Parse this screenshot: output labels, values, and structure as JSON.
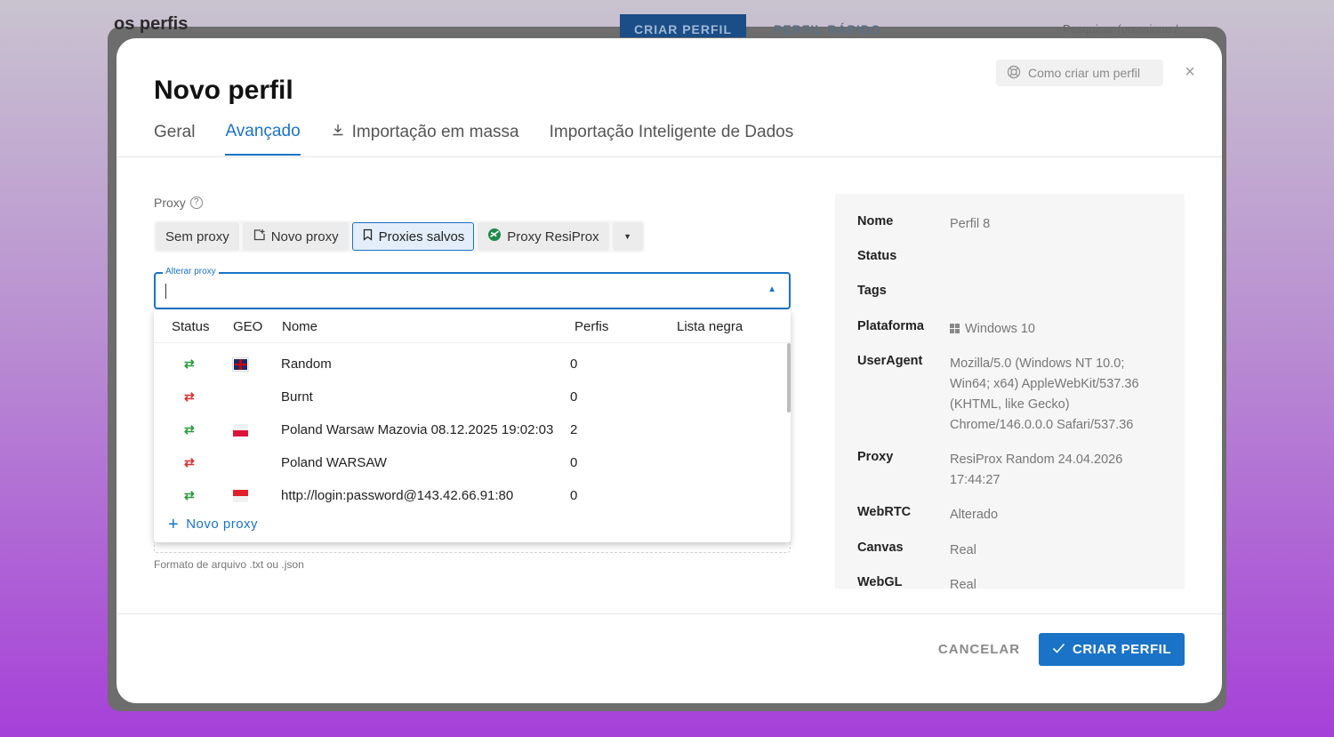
{
  "background_app": {
    "title": "os perfis",
    "create_button": "CRIAR PERFIL",
    "quick_profile_button": "PERFIL RÁPIDO",
    "search_placeholder": "Pesquisar (pressione /"
  },
  "modal": {
    "title": "Novo perfil",
    "help_button": "Como criar um perfil",
    "close_icon": "close-icon",
    "tabs": [
      {
        "label": "Geral",
        "active": false
      },
      {
        "label": "Avançado",
        "active": true
      },
      {
        "label": "Importação em massa",
        "icon": "download-icon",
        "active": false
      },
      {
        "label": "Importação Inteligente de Dados",
        "active": false
      }
    ]
  },
  "proxy": {
    "label": "Proxy",
    "options": [
      {
        "label": "Sem proxy"
      },
      {
        "label": "Novo proxy",
        "icon": "new-window-icon"
      },
      {
        "label": "Proxies salvos",
        "icon": "bookmark-icon",
        "selected": true
      },
      {
        "label": "Proxy ResiProx",
        "icon": "resiprox-logo-icon"
      }
    ],
    "select": {
      "legend": "Alterar proxy",
      "value": ""
    },
    "table": {
      "headers": [
        "Status",
        "GEO",
        "Nome",
        "Perfis",
        "Lista negra"
      ],
      "rows": [
        {
          "status": "ok",
          "geo": "uk",
          "name": "Random",
          "profiles": "0"
        },
        {
          "status": "bad",
          "geo": "",
          "name": "Burnt",
          "profiles": "0"
        },
        {
          "status": "ok",
          "geo": "pl",
          "name": "Poland Warsaw Mazovia 08.12.2025 19:02:03",
          "profiles": "2"
        },
        {
          "status": "bad",
          "geo": "",
          "name": "Poland WARSAW",
          "profiles": "0"
        },
        {
          "status": "ok",
          "geo": "sg",
          "name": "http://login:password@143.42.66.91:80",
          "profiles": "0"
        }
      ],
      "add_label": "Novo proxy"
    },
    "file_hint": "Formato de arquivo .txt ou .json"
  },
  "summary": {
    "rows": [
      {
        "key": "Nome",
        "value": "Perfil 8"
      },
      {
        "key": "Status",
        "value": ""
      },
      {
        "key": "Tags",
        "value": ""
      },
      {
        "key": "Plataforma",
        "value": "Windows 10"
      },
      {
        "key": "UserAgent",
        "value": "Mozilla/5.0 (Windows NT 10.0; Win64; x64) AppleWebKit/537.36 (KHTML, like Gecko) Chrome/146.0.0.0 Safari/537.36"
      },
      {
        "key": "Proxy",
        "value": "ResiProx Random 24.04.2026 17:44:27"
      },
      {
        "key": "WebRTC",
        "value": "Alterado"
      },
      {
        "key": "Canvas",
        "value": "Real"
      },
      {
        "key": "WebGL",
        "value": "Real"
      }
    ]
  },
  "footer": {
    "cancel": "CANCELAR",
    "create": "CRIAR PERFIL"
  },
  "colors": {
    "accent": "#1a73c7",
    "status_ok": "#2a9a3a",
    "status_bad": "#d93030"
  }
}
